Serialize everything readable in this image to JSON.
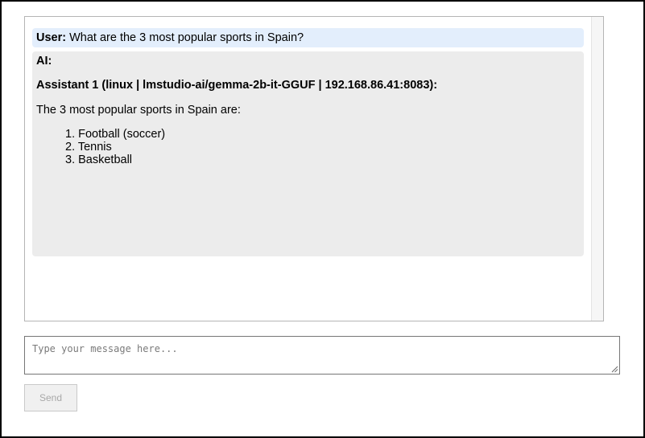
{
  "chat": {
    "user_label": "User:",
    "user_text": "What are the 3 most popular sports in Spain?",
    "ai_label": "AI:",
    "assistant_header": "Assistant 1 (linux | lmstudio-ai/gemma-2b-it-GGUF | 192.168.86.41:8083):",
    "intro": "The 3 most popular sports in Spain are:",
    "items": [
      "1. Football (soccer)",
      "2. Tennis",
      "3. Basketball"
    ]
  },
  "composer": {
    "placeholder": "Type your message here...",
    "value": "",
    "send_label": "Send",
    "send_disabled": true
  },
  "colors": {
    "user_bubble": "#e3eefc",
    "ai_bubble": "#ececec",
    "frame_border": "#000000"
  }
}
